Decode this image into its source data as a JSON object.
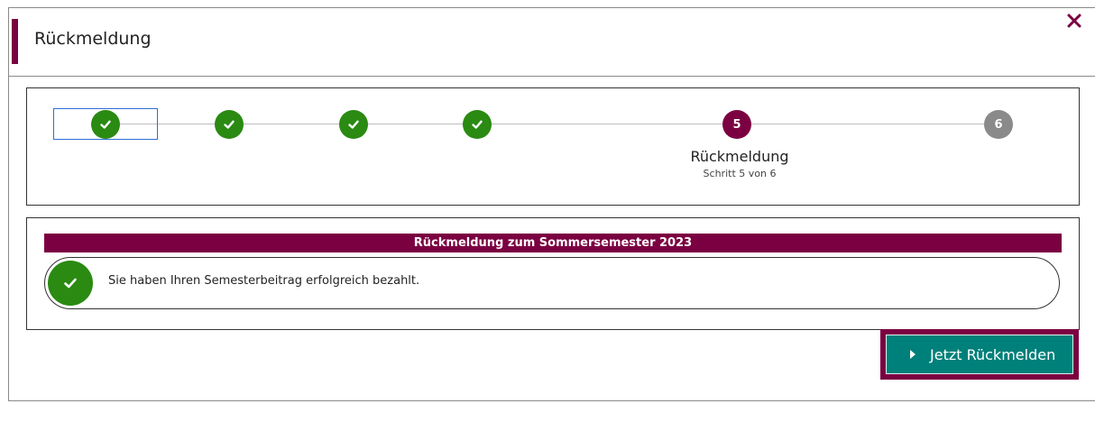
{
  "dialog": {
    "title": "Rückmeldung",
    "close_icon": "close-icon"
  },
  "stepper": {
    "steps": [
      {
        "number": "1",
        "state": "done",
        "icon": "check-icon"
      },
      {
        "number": "2",
        "state": "done",
        "icon": "check-icon"
      },
      {
        "number": "3",
        "state": "done",
        "icon": "check-icon"
      },
      {
        "number": "4",
        "state": "done",
        "icon": "check-icon"
      },
      {
        "number": "5",
        "state": "current"
      },
      {
        "number": "6",
        "state": "pending"
      }
    ],
    "current_label": "Rückmeldung",
    "current_sublabel": "Schritt 5 von 6"
  },
  "content": {
    "header": "Rückmeldung zum Sommersemester 2023",
    "message": "Sie haben Ihren Semesterbeitrag erfolgreich bezahlt.",
    "message_icon": "check-circle-icon"
  },
  "actions": {
    "submit_label": "Jetzt Rückmelden",
    "submit_icon": "chevron-right-icon"
  },
  "colors": {
    "accent": "#7b0041",
    "success": "#2a8a12",
    "pending": "#8a8a8a",
    "button": "#00807a"
  }
}
